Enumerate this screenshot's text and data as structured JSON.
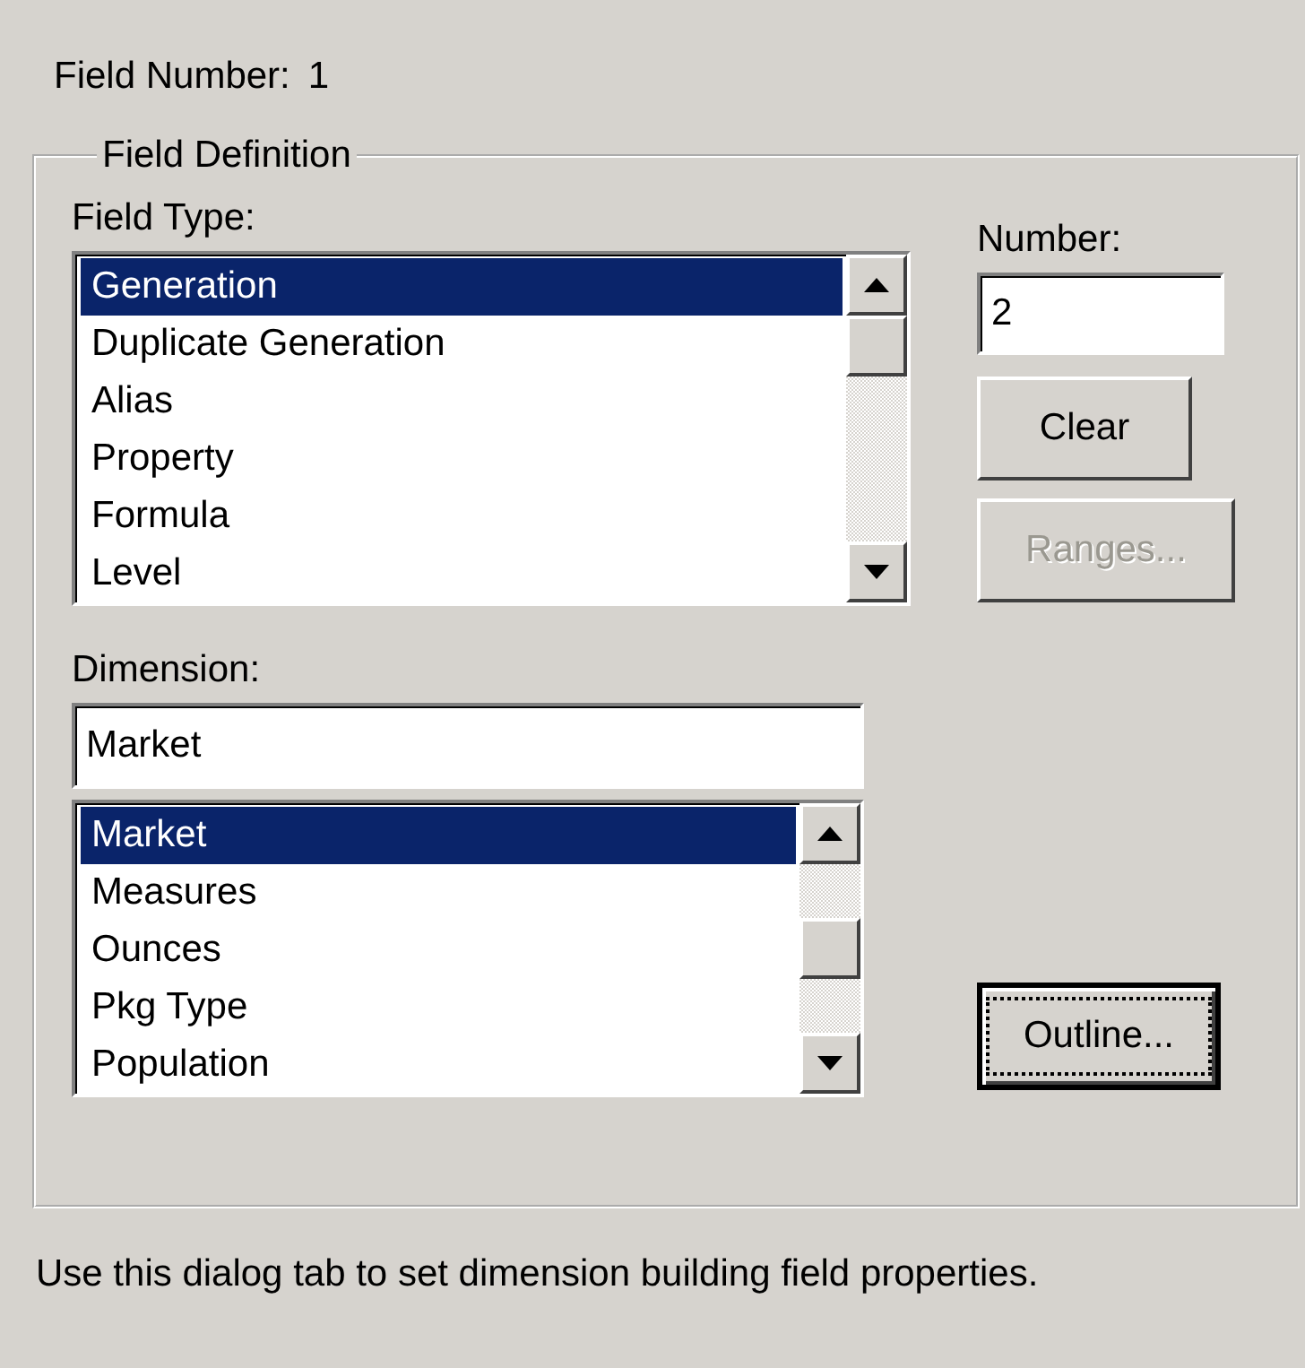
{
  "field_number": {
    "label": "Field Number:",
    "value": "1"
  },
  "group": {
    "title": "Field Definition"
  },
  "field_type": {
    "label": "Field Type:",
    "items": [
      {
        "text": "Generation",
        "selected": true
      },
      {
        "text": "Duplicate Generation",
        "selected": false
      },
      {
        "text": "Alias",
        "selected": false
      },
      {
        "text": "Property",
        "selected": false
      },
      {
        "text": "Formula",
        "selected": false
      },
      {
        "text": "Level",
        "selected": false
      }
    ]
  },
  "number": {
    "label": "Number:",
    "value": "2"
  },
  "buttons": [
    {
      "label": "Clear",
      "disabled": false
    },
    {
      "label": "Ranges...",
      "disabled": true
    }
  ],
  "dimension": {
    "label": "Dimension:",
    "value": "Market",
    "items": [
      {
        "text": "Market",
        "selected": true
      },
      {
        "text": "Measures",
        "selected": false
      },
      {
        "text": "Ounces",
        "selected": false
      },
      {
        "text": "Pkg Type",
        "selected": false
      },
      {
        "text": "Population",
        "selected": false
      }
    ]
  },
  "outline_button": {
    "label": "Outline...",
    "focused": true
  },
  "status": "Use this dialog tab to set dimension building field properties."
}
